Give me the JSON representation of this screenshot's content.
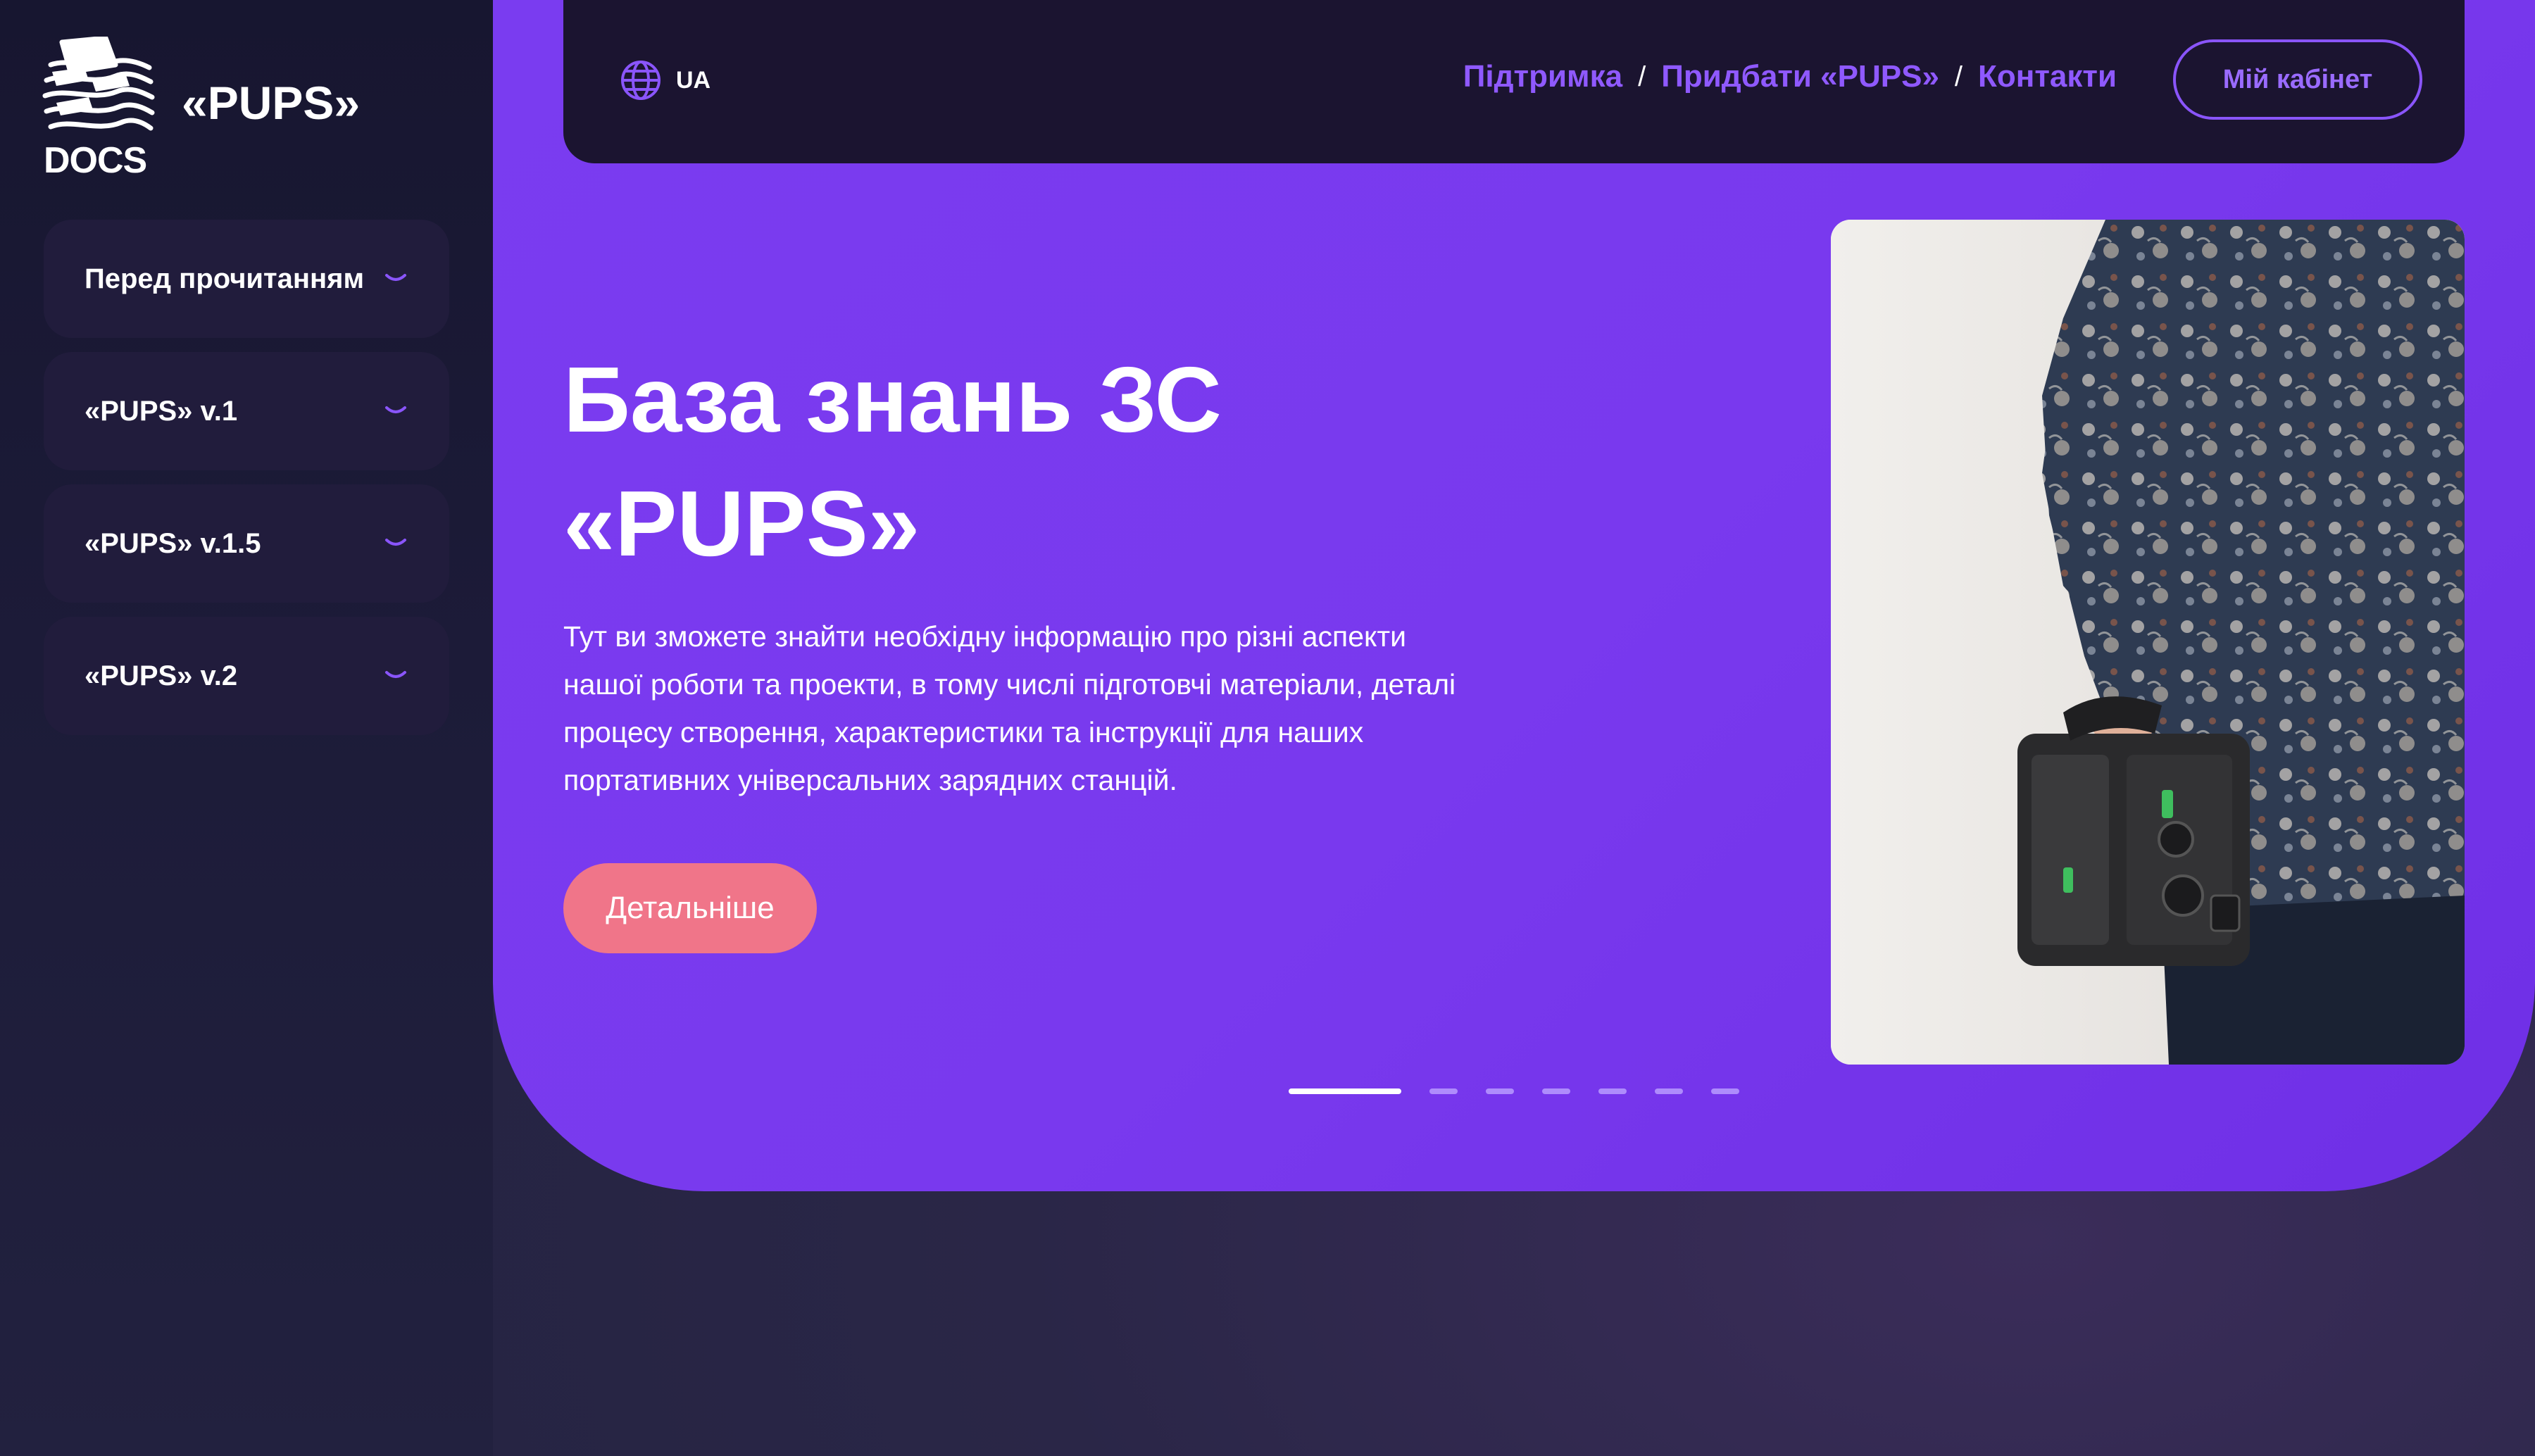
{
  "brand": {
    "logo_text": "DOCS",
    "name": "«PUPS»"
  },
  "sidebar": {
    "items": [
      {
        "label": "Перед прочитанням"
      },
      {
        "label": "«PUPS» v.1"
      },
      {
        "label": "«PUPS» v.1.5"
      },
      {
        "label": "«PUPS» v.2"
      }
    ]
  },
  "header": {
    "language": "UA",
    "nav": [
      {
        "label": "Підтримка"
      },
      {
        "label": "Придбати «PUPS»"
      },
      {
        "label": "Контакти"
      }
    ],
    "separator": "/",
    "cabinet_label": "Мій кабінет"
  },
  "hero": {
    "title_line1": "База знань ЗС",
    "title_line2": "«PUPS»",
    "description": "Тут ви зможете знайти необхідну інформацію про різні аспекти нашої роботи та проекти, в тому числі підготовчі матеріали, деталі процесу створення, характеристики та інструкції для наших портативних універсальних зарядних станцій.",
    "button_label": "Детальніше"
  },
  "slider": {
    "total": 7,
    "active_index": 0
  },
  "colors": {
    "accent": "#7a3cf0",
    "nav_link": "#8f59ff",
    "button": "#f07589",
    "sidebar_bg": "#171630",
    "topbar_bg": "#1b1430"
  }
}
